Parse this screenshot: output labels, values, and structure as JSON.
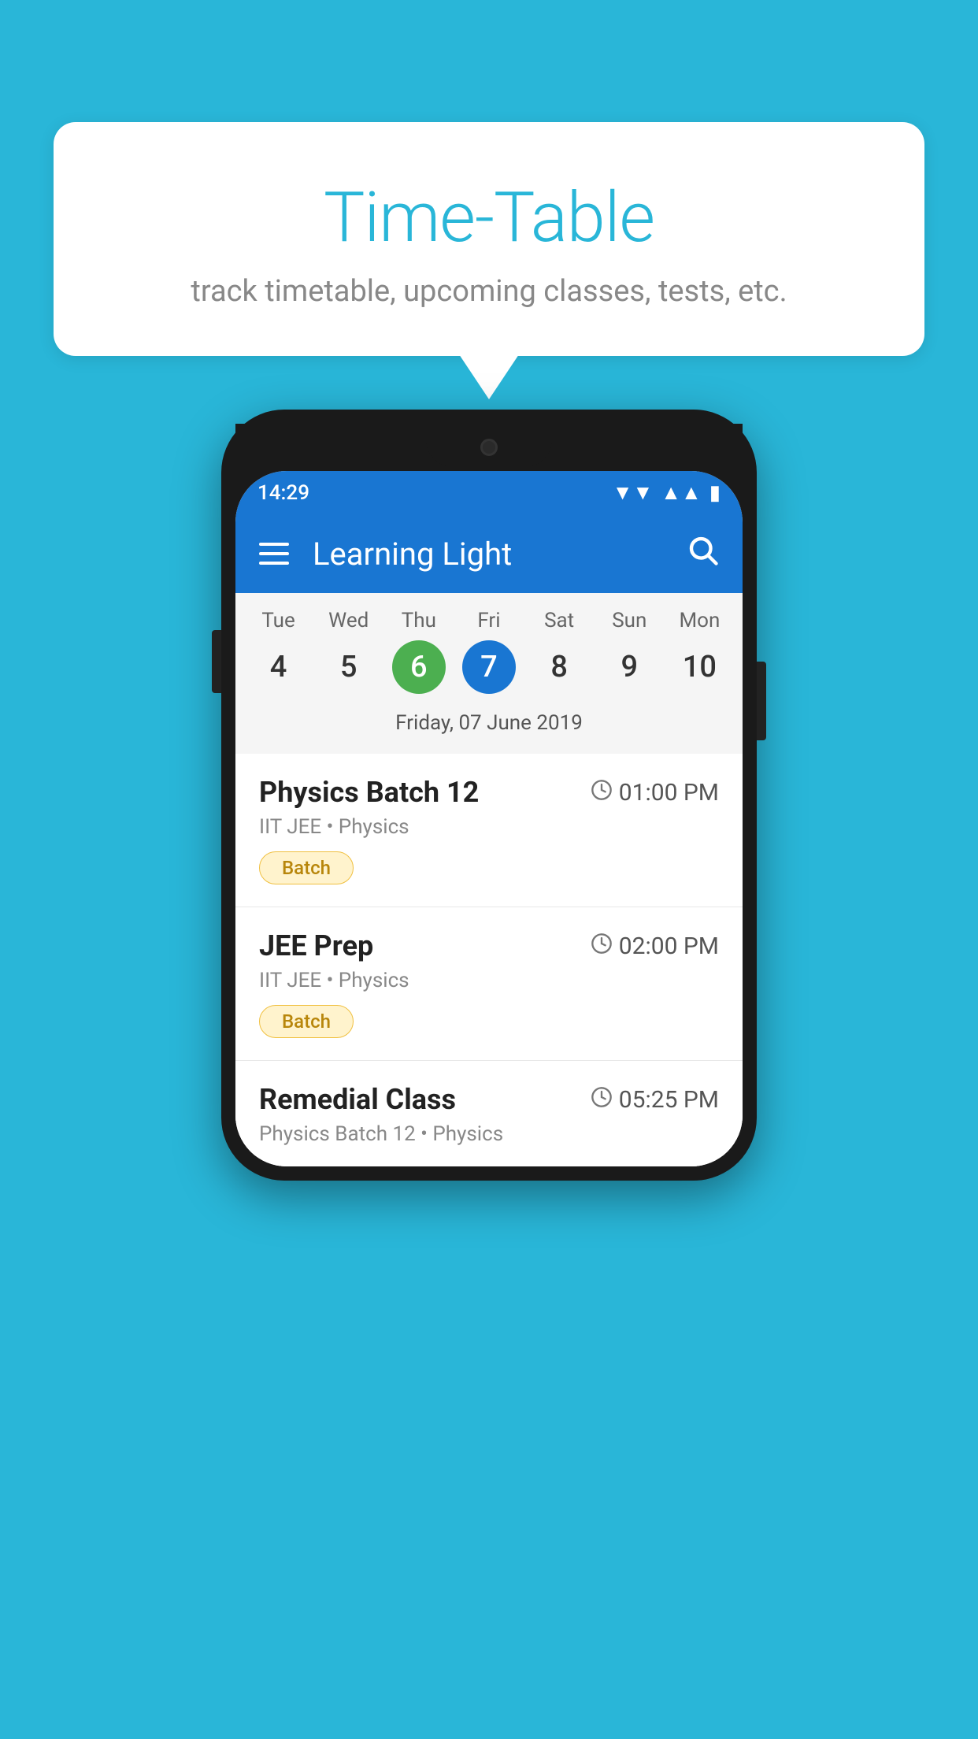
{
  "background_color": "#29B6D8",
  "bubble": {
    "title": "Time-Table",
    "subtitle": "track timetable, upcoming classes, tests, etc."
  },
  "phone": {
    "status_bar": {
      "time": "14:29"
    },
    "app_bar": {
      "title": "Learning Light"
    },
    "calendar": {
      "days": [
        {
          "name": "Tue",
          "num": "4",
          "state": "normal"
        },
        {
          "name": "Wed",
          "num": "5",
          "state": "normal"
        },
        {
          "name": "Thu",
          "num": "6",
          "state": "today"
        },
        {
          "name": "Fri",
          "num": "7",
          "state": "selected"
        },
        {
          "name": "Sat",
          "num": "8",
          "state": "normal"
        },
        {
          "name": "Sun",
          "num": "9",
          "state": "normal"
        },
        {
          "name": "Mon",
          "num": "10",
          "state": "normal"
        }
      ],
      "selected_date": "Friday, 07 June 2019"
    },
    "classes": [
      {
        "name": "Physics Batch 12",
        "time": "01:00 PM",
        "meta": "IIT JEE • Physics",
        "tag": "Batch"
      },
      {
        "name": "JEE Prep",
        "time": "02:00 PM",
        "meta": "IIT JEE • Physics",
        "tag": "Batch"
      },
      {
        "name": "Remedial Class",
        "time": "05:25 PM",
        "meta": "Physics Batch 12 • Physics",
        "tag": ""
      }
    ]
  }
}
